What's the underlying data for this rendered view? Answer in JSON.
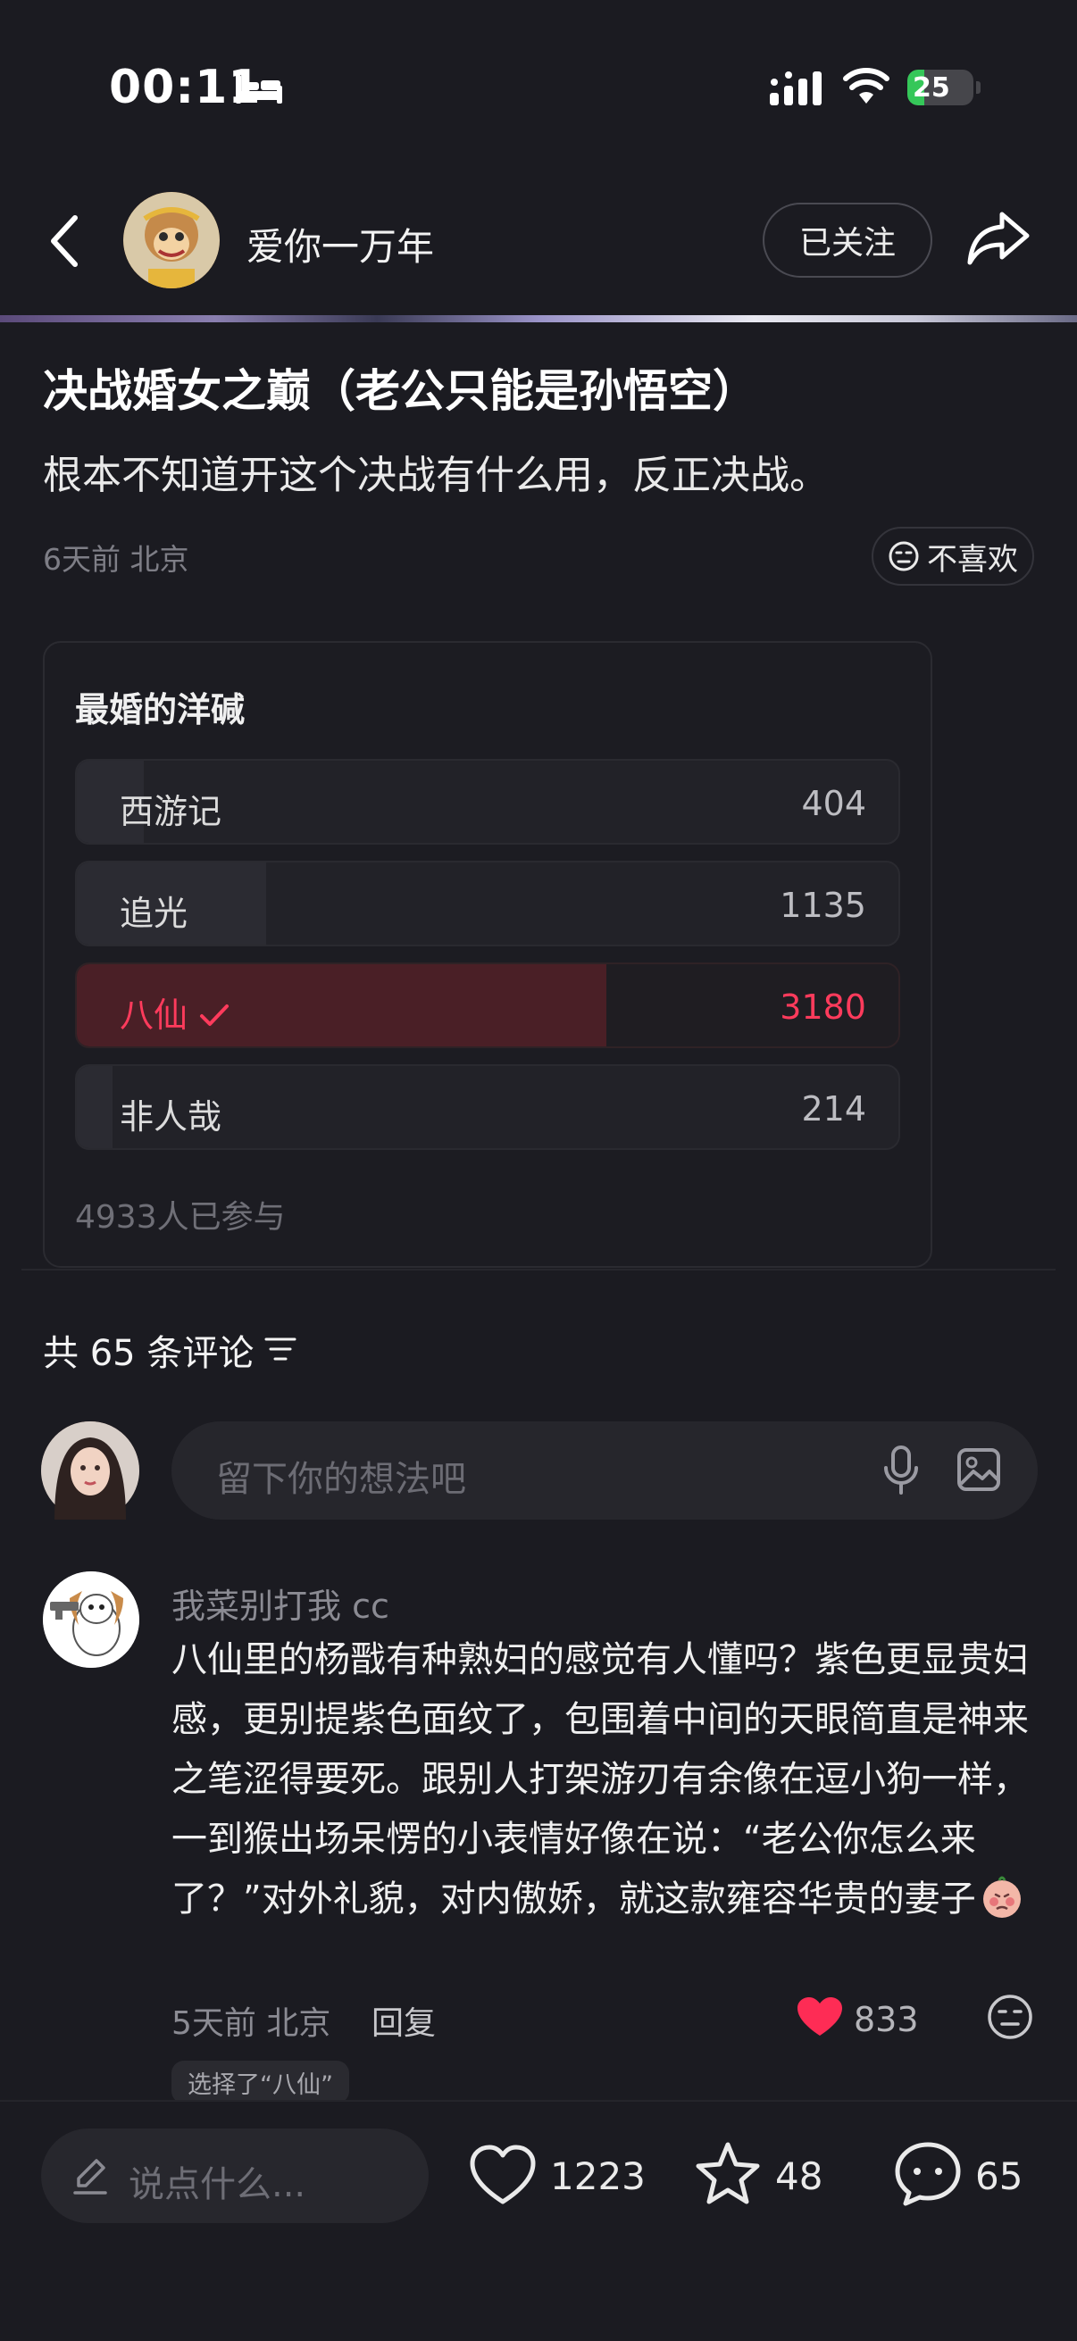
{
  "status_bar": {
    "time": "00:11",
    "battery": "25",
    "battery_level": 0.25
  },
  "header": {
    "author_name": "爱你一万年",
    "follow_label": "已关注"
  },
  "post": {
    "title": "决战婚女之巅（老公只能是孙悟空）",
    "body": "根本不知道开这个决战有什么用，反正决战。",
    "meta": "6天前 北京",
    "dislike_label": "不喜欢"
  },
  "poll": {
    "title": "最婚的洋碱",
    "options": [
      {
        "label": "西游记",
        "count": "404",
        "share": 0.082,
        "chosen": false
      },
      {
        "label": "追光",
        "count": "1135",
        "share": 0.23,
        "chosen": false
      },
      {
        "label": "八仙",
        "count": "3180",
        "share": 0.645,
        "chosen": true
      },
      {
        "label": "非人哉",
        "count": "214",
        "share": 0.043,
        "chosen": false
      }
    ],
    "participants": "4933人已参与"
  },
  "comments": {
    "header": "共 65 条评论",
    "input_placeholder": "留下你的想法吧",
    "items": [
      {
        "name": "我菜别打我 cc",
        "text": "八仙里的杨戬有种熟妇的感觉有人懂吗？紫色更显贵妇感，更别提紫色面纹了，包围着中间的天眼简直是神来之笔涩得要死。跟别人打架游刃有余像在逗小狗一样，一到猴出场呆愣的小表情好像在说：“老公你怎么来了？”对外礼貌，对内傲娇，就这款雍容华贵的妻子",
        "meta": "5天前 北京",
        "reply_label": "回复",
        "likes": "833",
        "chosen_tag": "选择了“八仙”"
      }
    ]
  },
  "bottom_bar": {
    "input_placeholder": "说点什么...",
    "likes": "1223",
    "stars": "48",
    "comments": "65"
  }
}
